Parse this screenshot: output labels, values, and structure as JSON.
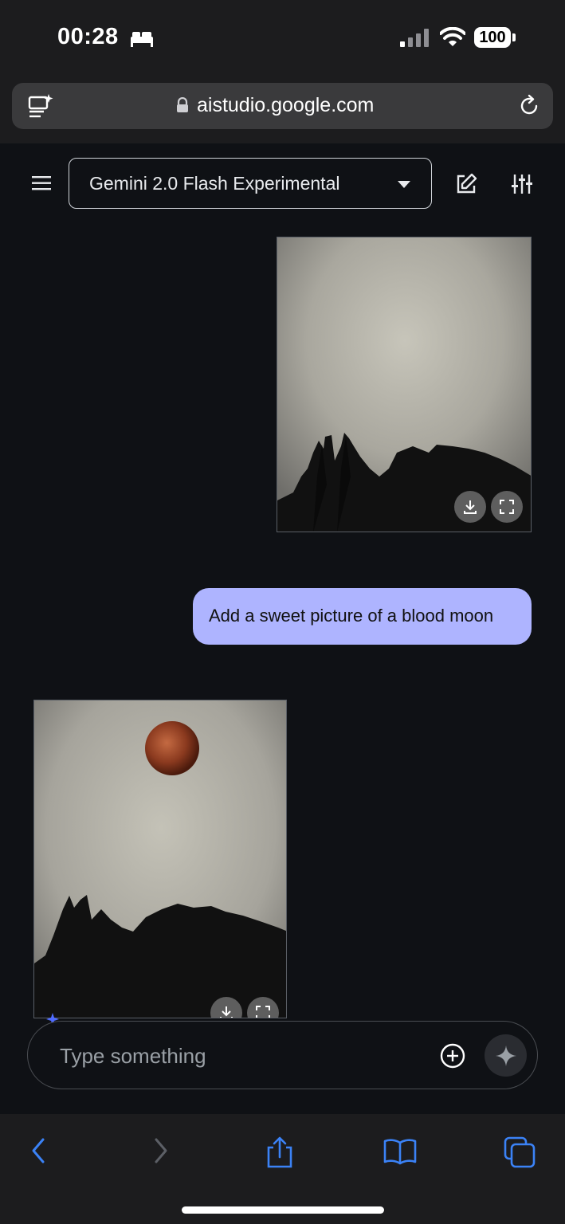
{
  "status_bar": {
    "time": "00:28",
    "battery": "100"
  },
  "browser": {
    "url": "aistudio.google.com"
  },
  "header": {
    "model_label": "Gemini 2.0 Flash Experimental"
  },
  "chat": {
    "user_message": "Add a sweet picture of a blood moon"
  },
  "composer": {
    "placeholder": "Type something"
  },
  "colors": {
    "accent_bubble": "#aeb4ff",
    "browser_tint": "#1c1c1e",
    "background": "#0f1115"
  }
}
